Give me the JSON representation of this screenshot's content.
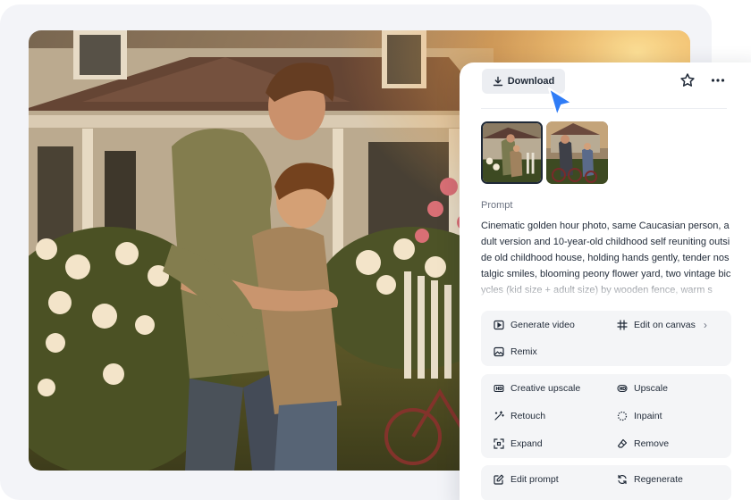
{
  "toolbar": {
    "download_label": "Download"
  },
  "prompt": {
    "label": "Prompt",
    "text": "Cinematic golden hour photo, same Caucasian person, adult version and 10-year-old childhood self reuniting outside old childhood house, holding hands gently, tender nostalgic smiles, blooming peony flower yard, two vintage bicycles (kid size + adult size) by wooden fence, warm s"
  },
  "actions": {
    "generate_video": "Generate video",
    "edit_on_canvas": "Edit on canvas",
    "edit_on_canvas_chevron": "›",
    "remix": "Remix",
    "creative_upscale": "Creative upscale",
    "upscale": "Upscale",
    "retouch": "Retouch",
    "inpaint": "Inpaint",
    "expand": "Expand",
    "remove": "Remove",
    "edit_prompt": "Edit prompt",
    "regenerate": "Regenerate"
  },
  "icons": {
    "download": "download-icon",
    "star": "star-icon",
    "more": "more-horizontal-icon",
    "cursor": "pointer-cursor-icon",
    "generate_video": "play-square-icon",
    "edit_on_canvas": "hashtag-frame-icon",
    "remix": "image-icon",
    "creative_upscale": "hd-sparkle-icon",
    "upscale": "hd-icon",
    "retouch": "magic-wand-icon",
    "inpaint": "dotted-circle-icon",
    "expand": "expand-icon",
    "remove": "eraser-icon",
    "edit_prompt": "edit-box-icon",
    "regenerate": "refresh-icon"
  },
  "colors": {
    "accent_cursor": "#2f7cf6",
    "panel_bg": "#ffffff",
    "group_bg": "#f4f5f7",
    "canvas_bg": "#f3f4f8",
    "text_primary": "#1f2937",
    "text_muted": "#6b7280"
  }
}
